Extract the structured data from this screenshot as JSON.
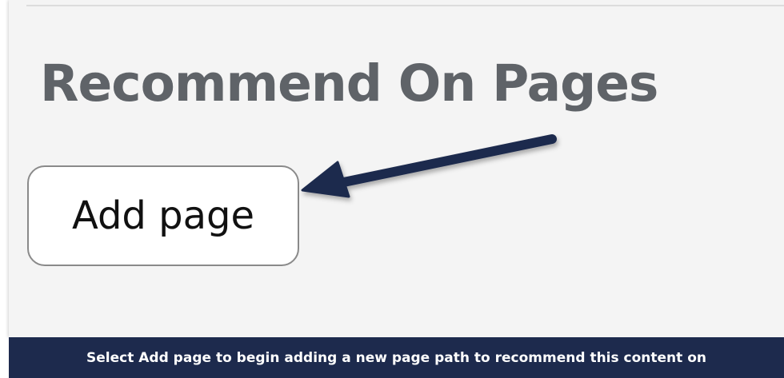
{
  "section": {
    "title": "Recommend On Pages"
  },
  "actions": {
    "add_page_label": "Add page"
  },
  "annotation": {
    "arrow_color": "#1d2a4d",
    "caption": "Select Add page to begin adding a new page path to recommend this content on"
  },
  "colors": {
    "panel_background": "#f4f4f4",
    "title_text": "#5f6368",
    "caption_background": "#1d2a4d",
    "caption_text": "#ffffff"
  }
}
